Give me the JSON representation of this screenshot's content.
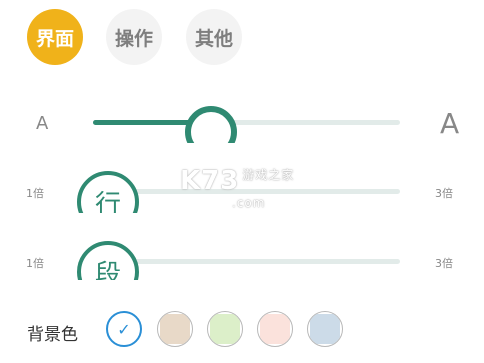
{
  "tabs": [
    {
      "label": "界面",
      "active": true
    },
    {
      "label": "操作",
      "active": false
    },
    {
      "label": "其他",
      "active": false
    }
  ],
  "font_size": {
    "small_label": "A",
    "large_label": "A",
    "level": 0.36
  },
  "line_spacing": {
    "knob_char": "行",
    "min_label": "1倍",
    "max_label": "3倍"
  },
  "paragraph_spacing": {
    "knob_char": "段",
    "min_label": "1倍",
    "max_label": "3倍"
  },
  "background": {
    "label": "背景色",
    "selected_index": 0,
    "colors": [
      "#ffffff",
      "#e8d9c8",
      "#dcefc9",
      "#fbe2dc",
      "#ccdbe8"
    ]
  },
  "watermark": {
    "brand": "K73",
    "sub": "游戏之家",
    "domain": ".com"
  },
  "colors": {
    "accent_tab": "#f0b21a",
    "slider": "#2f8a72",
    "check": "#2a8fd6"
  }
}
